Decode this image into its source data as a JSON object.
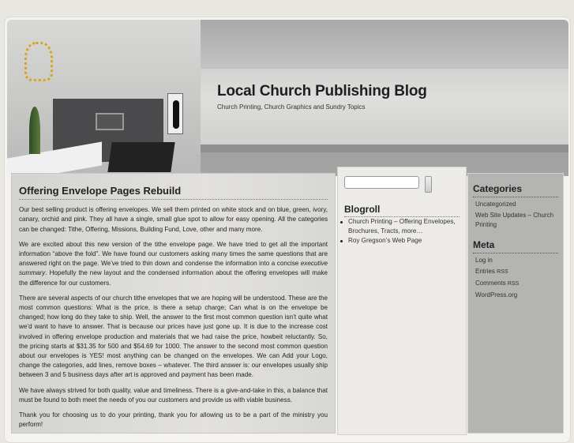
{
  "header": {
    "title": "Local Church Publishing Blog",
    "description": "Church Printing, Church Graphics and Sundry Topics"
  },
  "post": {
    "title": "Offering Envelope Pages Rebuild",
    "p1": "Our best selling product is offering envelopes. We sell them printed on white stock and on blue, green, ivory, canary, orchid and pink. They all have a single, small glue spot to allow for easy opening. All the categories can be changed: Tithe, Offering, Missions, Building Fund, Love, other and many more.",
    "p2a": "We are excited about this new version of the tithe envelope page. We have tried to get all the important information “above the fold”. We have found our customers asking many times the same questions that are answered right on the page. We’ve tried to thin down and condense the information into a concise ",
    "p2em": "executive summary",
    "p2b": ". Hopefully the new layout and the condensed information about the offering envelopes will make the difference for our customers.",
    "p3": "There are several aspects of our church tithe envelopes that we are hoping will be understood. These are the most common questions: What is the price, is there a setup charge; Can what is on the envelope be changed; how long do they take to ship. Well, the answer to the first most common question isn’t quite what we’d want to have to answer. That is because our prices have just gone up. It is due to the increase cost involved in offering envelope production and materials that we had raise the price, howbeit reluctantly. So, the pricing starts at $31.35 for 500 and $54.69 for 1000. The answer to the second most common question about our envelopes is YES! most anything can be changed on the envelopes. We can Add your Logo, change the categories, add lines, remove boxes – whatever. The third answer is: our envelopes usually ship between 3 and 5 business days after art is approved and payment has been made.",
    "p4": "We have always strived for both quality, value and timeliness. There is a give-and-take in this, a balance that must be found to both meet the needs of you our customers and provide us with viable business.",
    "p5": "Thank you for choosing us to do your printing, thank you for allowing us to be a part of the ministry you perform!"
  },
  "search": {
    "value": ""
  },
  "blogroll": {
    "title": "Blogroll",
    "links": [
      "Church Printing – Offering Envelopes, Brochures, Tracts, more…",
      "Roy Gregson’s Web Page"
    ]
  },
  "categories": {
    "title": "Categories",
    "items": [
      "Uncategorized",
      "Web Site Updates – Church Printing"
    ]
  },
  "meta": {
    "title": "Meta",
    "login": "Log in",
    "entries": "Entries",
    "comments": "Comments",
    "rss": "RSS",
    "wordpress": "WordPress.org"
  }
}
